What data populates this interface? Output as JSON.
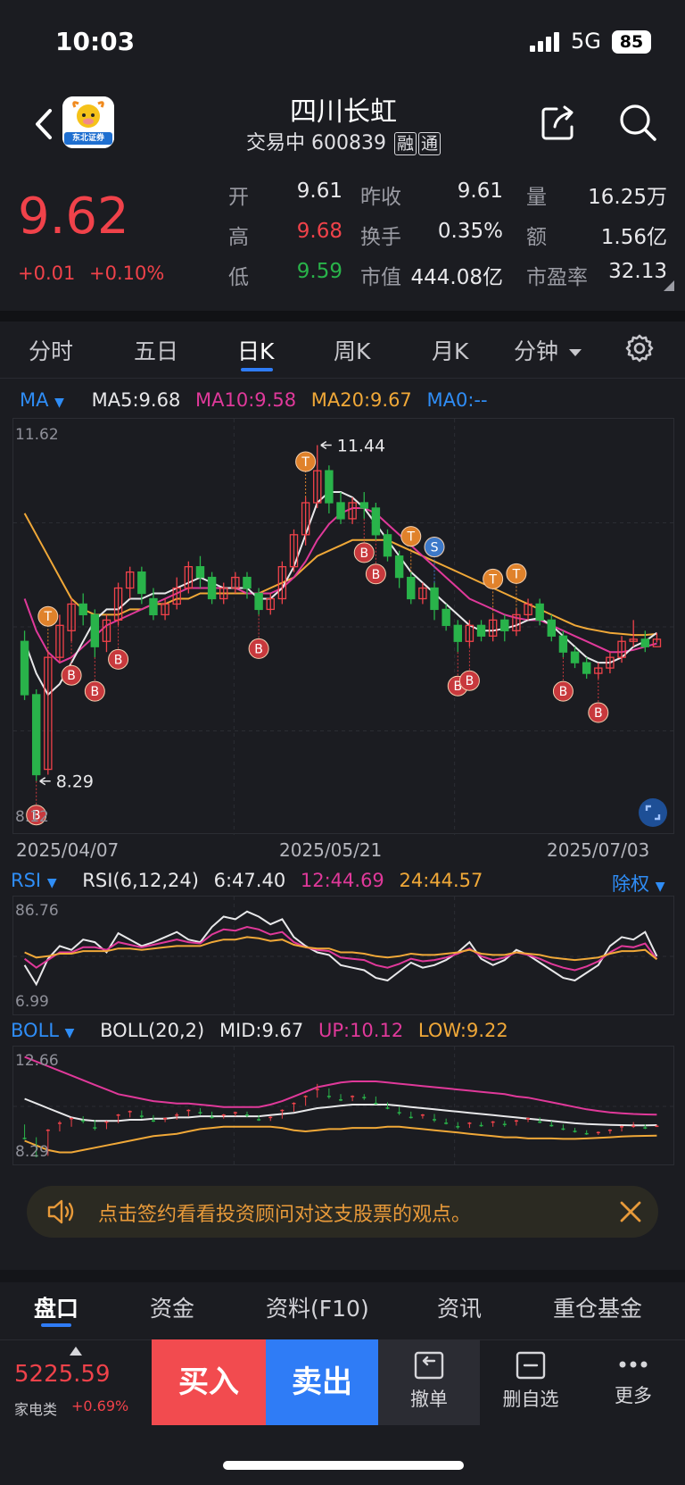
{
  "status_bar": {
    "time": "10:03",
    "network": "5G",
    "battery": "85"
  },
  "header": {
    "stock_name": "四川长虹",
    "trading_status": "交易中",
    "stock_code": "600839",
    "tag_margin": "融",
    "tag_connect": "通",
    "logo_text": "东北证券"
  },
  "quote": {
    "price": "9.62",
    "change": "+0.01",
    "change_pct": "+0.10%",
    "fields": [
      {
        "label": "开",
        "value": "9.61",
        "tone": "white"
      },
      {
        "label": "昨收",
        "value": "9.61",
        "tone": "white"
      },
      {
        "label": "量",
        "value": "16.25万",
        "tone": "white"
      },
      {
        "label": "高",
        "value": "9.68",
        "tone": "red"
      },
      {
        "label": "换手",
        "value": "0.35%",
        "tone": "white"
      },
      {
        "label": "额",
        "value": "1.56亿",
        "tone": "white"
      },
      {
        "label": "低",
        "value": "9.59",
        "tone": "green"
      },
      {
        "label": "市值",
        "value": "444.08亿",
        "tone": "white"
      },
      {
        "label": "市盈率",
        "value": "32.13",
        "tone": "white"
      }
    ]
  },
  "period_tabs": [
    "分时",
    "五日",
    "日K",
    "周K",
    "月K",
    "分钟"
  ],
  "active_period": "日K",
  "ma_line": {
    "selector": "MA",
    "ma5": "MA5:9.68",
    "ma10": "MA10:9.58",
    "ma20": "MA20:9.67",
    "ma0": "MA0:--"
  },
  "rsi_line": {
    "selector": "RSI",
    "params": "RSI(6,12,24)",
    "rsi6": "6:47.40",
    "rsi12": "12:44.69",
    "rsi24": "24:44.57",
    "adjust": "除权"
  },
  "boll_line": {
    "selector": "BOLL",
    "params": "BOLL(20,2)",
    "mid": "MID:9.67",
    "up": "UP:10.12",
    "low": "LOW:9.22"
  },
  "colors": {
    "up": "#f0424a",
    "down": "#29b34a",
    "ma5": "#e8e8ea",
    "ma10": "#e0399a",
    "ma20": "#f0a838",
    "accent": "#2f7cf6",
    "marker_t": "#e0822b",
    "marker_b": "#c8393d",
    "marker_s": "#3d79c9"
  },
  "chart_data": [
    {
      "type": "candlestick",
      "title": "",
      "ylim": [
        8.12,
        11.62
      ],
      "y_ticks": [
        "11.62",
        "8.12"
      ],
      "dates": [
        "2025/04/07",
        "2025/05/21",
        "2025/07/03"
      ],
      "high_label": "11.44",
      "low_label": "8.29",
      "candles": [
        [
          9.6,
          9.1,
          9.7,
          9.05
        ],
        [
          9.1,
          8.35,
          9.15,
          8.29
        ],
        [
          8.4,
          9.45,
          9.5,
          8.35
        ],
        [
          9.45,
          9.75,
          9.85,
          9.4
        ],
        [
          9.7,
          9.95,
          10.0,
          9.6
        ],
        [
          9.95,
          9.85,
          10.05,
          9.75
        ],
        [
          9.85,
          9.55,
          9.9,
          9.45
        ],
        [
          9.6,
          9.8,
          9.85,
          9.5
        ],
        [
          9.8,
          10.1,
          10.15,
          9.75
        ],
        [
          10.1,
          10.25,
          10.3,
          10.0
        ],
        [
          10.25,
          10.05,
          10.3,
          9.95
        ],
        [
          10.0,
          9.85,
          10.1,
          9.8
        ],
        [
          9.85,
          9.95,
          10.0,
          9.8
        ],
        [
          9.95,
          10.1,
          10.2,
          9.9
        ],
        [
          10.1,
          10.3,
          10.35,
          10.05
        ],
        [
          10.3,
          10.2,
          10.4,
          10.1
        ],
        [
          10.2,
          10.0,
          10.25,
          9.95
        ],
        [
          10.0,
          10.1,
          10.15,
          9.95
        ],
        [
          10.1,
          10.2,
          10.25,
          10.05
        ],
        [
          10.2,
          10.1,
          10.25,
          10.0
        ],
        [
          10.05,
          9.9,
          10.1,
          9.85
        ],
        [
          9.9,
          10.0,
          10.05,
          9.85
        ],
        [
          10.0,
          10.3,
          10.35,
          9.95
        ],
        [
          10.3,
          10.6,
          10.65,
          10.25
        ],
        [
          10.6,
          10.9,
          10.95,
          10.5
        ],
        [
          10.9,
          11.2,
          11.44,
          10.85
        ],
        [
          11.2,
          10.9,
          11.25,
          10.8
        ],
        [
          10.9,
          10.75,
          11.0,
          10.7
        ],
        [
          10.75,
          10.9,
          10.95,
          10.7
        ],
        [
          10.9,
          10.85,
          11.0,
          10.75
        ],
        [
          10.85,
          10.6,
          10.9,
          10.55
        ],
        [
          10.6,
          10.4,
          10.65,
          10.35
        ],
        [
          10.4,
          10.2,
          10.45,
          10.1
        ],
        [
          10.2,
          10.0,
          10.25,
          9.95
        ],
        [
          10.0,
          10.1,
          10.15,
          9.95
        ],
        [
          10.1,
          9.9,
          10.15,
          9.8
        ],
        [
          9.9,
          9.75,
          9.95,
          9.7
        ],
        [
          9.75,
          9.6,
          9.8,
          9.5
        ],
        [
          9.6,
          9.75,
          9.8,
          9.55
        ],
        [
          9.75,
          9.65,
          9.8,
          9.6
        ],
        [
          9.65,
          9.8,
          9.85,
          9.6
        ],
        [
          9.8,
          9.7,
          9.85,
          9.6
        ],
        [
          9.7,
          9.85,
          9.9,
          9.65
        ],
        [
          9.85,
          9.95,
          10.0,
          9.8
        ],
        [
          9.95,
          9.8,
          10.0,
          9.75
        ],
        [
          9.8,
          9.65,
          9.85,
          9.6
        ],
        [
          9.65,
          9.5,
          9.7,
          9.45
        ],
        [
          9.5,
          9.4,
          9.55,
          9.35
        ],
        [
          9.4,
          9.3,
          9.45,
          9.25
        ],
        [
          9.3,
          9.35,
          9.4,
          9.25
        ],
        [
          9.35,
          9.45,
          9.5,
          9.3
        ],
        [
          9.45,
          9.6,
          9.65,
          9.4
        ],
        [
          9.6,
          9.62,
          9.8,
          9.55
        ],
        [
          9.62,
          9.55,
          9.7,
          9.5
        ],
        [
          9.55,
          9.62,
          9.68,
          9.59
        ]
      ],
      "ma5": [
        9.6,
        9.3,
        9.1,
        9.2,
        9.4,
        9.6,
        9.8,
        9.9,
        9.9,
        10.0,
        10.0,
        10.05,
        10.05,
        10.1,
        10.15,
        10.2,
        10.15,
        10.1,
        10.1,
        10.1,
        10.0,
        10.0,
        10.1,
        10.3,
        10.6,
        10.9,
        11.0,
        11.0,
        10.95,
        10.85,
        10.7,
        10.55,
        10.4,
        10.25,
        10.15,
        10.05,
        9.95,
        9.85,
        9.75,
        9.7,
        9.7,
        9.72,
        9.75,
        9.8,
        9.82,
        9.75,
        9.65,
        9.55,
        9.45,
        9.4,
        9.4,
        9.45,
        9.55,
        9.6,
        9.68
      ],
      "ma10": [
        10.0,
        9.7,
        9.5,
        9.4,
        9.45,
        9.55,
        9.65,
        9.75,
        9.8,
        9.85,
        9.9,
        9.95,
        10.0,
        10.05,
        10.1,
        10.1,
        10.1,
        10.1,
        10.1,
        10.05,
        10.05,
        10.05,
        10.1,
        10.2,
        10.35,
        10.55,
        10.7,
        10.8,
        10.85,
        10.85,
        10.8,
        10.7,
        10.6,
        10.5,
        10.4,
        10.3,
        10.2,
        10.1,
        10.0,
        9.95,
        9.9,
        9.85,
        9.82,
        9.8,
        9.8,
        9.75,
        9.7,
        9.65,
        9.6,
        9.55,
        9.5,
        9.5,
        9.52,
        9.55,
        9.58
      ],
      "ma20": [
        10.8,
        10.6,
        10.4,
        10.2,
        10.0,
        9.9,
        9.85,
        9.85,
        9.85,
        9.9,
        9.9,
        9.95,
        9.95,
        10.0,
        10.0,
        10.05,
        10.05,
        10.05,
        10.05,
        10.05,
        10.05,
        10.1,
        10.15,
        10.2,
        10.3,
        10.4,
        10.45,
        10.5,
        10.55,
        10.55,
        10.55,
        10.55,
        10.5,
        10.45,
        10.4,
        10.35,
        10.3,
        10.25,
        10.2,
        10.15,
        10.1,
        10.05,
        10.0,
        9.95,
        9.9,
        9.85,
        9.8,
        9.75,
        9.72,
        9.7,
        9.68,
        9.67,
        9.66,
        9.66,
        9.67
      ],
      "markers": [
        {
          "i": 1,
          "label": "B",
          "price_anchor": 8.29
        },
        {
          "i": 2,
          "label": "T",
          "price_anchor": 9.5
        },
        {
          "i": 4,
          "label": "B",
          "price_anchor": 9.6
        },
        {
          "i": 6,
          "label": "B",
          "price_anchor": 9.45
        },
        {
          "i": 8,
          "label": "B",
          "price_anchor": 9.75
        },
        {
          "i": 20,
          "label": "B",
          "price_anchor": 9.85
        },
        {
          "i": 24,
          "label": "T",
          "price_anchor": 10.95
        },
        {
          "i": 29,
          "label": "B",
          "price_anchor": 10.75
        },
        {
          "i": 30,
          "label": "B",
          "price_anchor": 10.55
        },
        {
          "i": 33,
          "label": "T",
          "price_anchor": 10.25
        },
        {
          "i": 35,
          "label": "S",
          "price_anchor": 10.15
        },
        {
          "i": 37,
          "label": "B",
          "price_anchor": 9.5
        },
        {
          "i": 38,
          "label": "B",
          "price_anchor": 9.55
        },
        {
          "i": 40,
          "label": "T",
          "price_anchor": 9.85
        },
        {
          "i": 42,
          "label": "T",
          "price_anchor": 9.9
        },
        {
          "i": 46,
          "label": "B",
          "price_anchor": 9.45
        },
        {
          "i": 49,
          "label": "B",
          "price_anchor": 9.25
        }
      ]
    },
    {
      "type": "line",
      "title": "",
      "ylim": [
        6.99,
        86.76
      ],
      "y_ticks": [
        "86.76",
        "6.99"
      ],
      "series": [
        {
          "name": "6",
          "values": [
            40,
            25,
            45,
            55,
            52,
            60,
            58,
            50,
            65,
            60,
            55,
            58,
            62,
            66,
            60,
            58,
            70,
            78,
            76,
            82,
            78,
            72,
            76,
            62,
            55,
            50,
            48,
            40,
            38,
            36,
            30,
            28,
            35,
            42,
            38,
            40,
            44,
            50,
            58,
            45,
            40,
            44,
            52,
            48,
            42,
            36,
            30,
            28,
            34,
            40,
            55,
            62,
            60,
            66,
            47
          ]
        },
        {
          "name": "12",
          "values": [
            45,
            38,
            44,
            50,
            50,
            54,
            54,
            52,
            58,
            56,
            54,
            56,
            58,
            60,
            58,
            57,
            64,
            68,
            67,
            70,
            68,
            64,
            66,
            58,
            54,
            52,
            51,
            46,
            45,
            44,
            40,
            38,
            41,
            45,
            43,
            44,
            46,
            49,
            53,
            47,
            44,
            46,
            50,
            48,
            45,
            41,
            38,
            36,
            39,
            43,
            50,
            55,
            54,
            57,
            44.69
          ]
        },
        {
          "name": "24",
          "values": [
            50,
            46,
            47,
            49,
            49,
            51,
            51,
            51,
            53,
            53,
            52,
            53,
            54,
            55,
            55,
            55,
            58,
            60,
            60,
            62,
            61,
            59,
            60,
            56,
            54,
            53,
            53,
            50,
            50,
            49,
            47,
            46,
            47,
            49,
            48,
            48,
            49,
            50,
            52,
            49,
            48,
            48,
            50,
            49,
            48,
            46,
            45,
            44,
            45,
            46,
            49,
            51,
            51,
            52,
            44.57
          ]
        }
      ]
    },
    {
      "type": "line",
      "title": "",
      "ylim": [
        8.29,
        12.66
      ],
      "y_ticks": [
        "12.66",
        "8.29"
      ],
      "series": [
        {
          "name": "MID",
          "values": [
            10.8,
            10.6,
            10.4,
            10.2,
            10.0,
            9.9,
            9.85,
            9.85,
            9.85,
            9.9,
            9.9,
            9.95,
            9.95,
            10.0,
            10.0,
            10.05,
            10.05,
            10.05,
            10.05,
            10.05,
            10.05,
            10.1,
            10.15,
            10.2,
            10.3,
            10.4,
            10.45,
            10.5,
            10.55,
            10.55,
            10.55,
            10.55,
            10.5,
            10.45,
            10.4,
            10.35,
            10.3,
            10.25,
            10.2,
            10.15,
            10.1,
            10.05,
            10.0,
            9.95,
            9.9,
            9.85,
            9.8,
            9.75,
            9.72,
            9.7,
            9.68,
            9.67,
            9.66,
            9.66,
            9.67
          ]
        },
        {
          "name": "UP",
          "values": [
            12.6,
            12.4,
            12.2,
            12.0,
            11.8,
            11.6,
            11.4,
            11.2,
            11.0,
            10.9,
            10.8,
            10.7,
            10.65,
            10.6,
            10.6,
            10.55,
            10.5,
            10.45,
            10.45,
            10.45,
            10.45,
            10.55,
            10.7,
            10.9,
            11.1,
            11.3,
            11.4,
            11.5,
            11.55,
            11.55,
            11.55,
            11.5,
            11.45,
            11.4,
            11.35,
            11.3,
            11.25,
            11.2,
            11.15,
            11.1,
            11.05,
            11.0,
            10.9,
            10.85,
            10.75,
            10.65,
            10.55,
            10.45,
            10.35,
            10.28,
            10.22,
            10.18,
            10.15,
            10.13,
            10.12
          ]
        },
        {
          "name": "LOW",
          "values": [
            9.0,
            8.8,
            8.6,
            8.5,
            8.5,
            8.6,
            8.7,
            8.8,
            8.9,
            9.0,
            9.1,
            9.2,
            9.25,
            9.3,
            9.4,
            9.5,
            9.55,
            9.6,
            9.6,
            9.6,
            9.6,
            9.6,
            9.55,
            9.45,
            9.4,
            9.45,
            9.5,
            9.5,
            9.55,
            9.55,
            9.55,
            9.6,
            9.6,
            9.55,
            9.5,
            9.45,
            9.4,
            9.35,
            9.3,
            9.25,
            9.2,
            9.15,
            9.15,
            9.1,
            9.1,
            9.1,
            9.08,
            9.08,
            9.1,
            9.12,
            9.15,
            9.18,
            9.2,
            9.21,
            9.22
          ]
        }
      ]
    }
  ],
  "promo": {
    "text": "点击签约看看投资顾问对这支股票的观点。"
  },
  "bottom_tabs": [
    "盘口",
    "资金",
    "资料(F10)",
    "资讯",
    "重仓基金"
  ],
  "action_bar": {
    "index_value": "5225.59",
    "index_name": "家电类",
    "index_change": "+0.69%",
    "buy": "买入",
    "sell": "卖出",
    "cancel": "撤单",
    "remove_watch": "删自选",
    "more": "更多"
  }
}
